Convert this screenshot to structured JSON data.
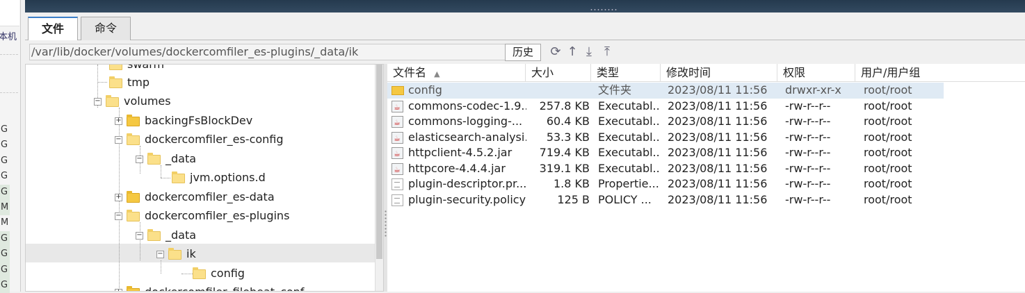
{
  "left_strip": {
    "host_label": "本机",
    "units": [
      "G",
      "G",
      "G",
      "G",
      "G",
      "M",
      "M",
      "G",
      "G",
      "G",
      "G"
    ]
  },
  "tabs": [
    {
      "label": "文件"
    },
    {
      "label": "命令"
    }
  ],
  "path_bar": {
    "path": "/var/lib/docker/volumes/dockercomfiler_es-plugins/_data/ik",
    "history_button": "历史",
    "icons": [
      "refresh-icon",
      "up-icon",
      "download-icon",
      "upload-icon"
    ]
  },
  "tree": {
    "nodes": [
      {
        "label": "swarm"
      },
      {
        "label": "tmp"
      },
      {
        "label": "volumes"
      },
      {
        "label": "backingFsBlockDev"
      },
      {
        "label": "dockercomfiler_es-config"
      },
      {
        "label": "_data"
      },
      {
        "label": "jvm.options.d"
      },
      {
        "label": "dockercomfiler_es-data"
      },
      {
        "label": "dockercomfiler_es-plugins"
      },
      {
        "label": "_data"
      },
      {
        "label": "ik"
      },
      {
        "label": "config"
      },
      {
        "label": "dockercomfiler_filebeat_conf"
      }
    ]
  },
  "file_list": {
    "columns": [
      "文件名",
      "大小",
      "类型",
      "修改时间",
      "权限",
      "用户/用户组"
    ],
    "sort_indicator": "▲",
    "rows": [
      {
        "icon": "folder-icon",
        "name": "config",
        "size": "",
        "type": "文件夹",
        "modified": "2023/08/11 11:56",
        "perm": "drwxr-xr-x",
        "owner": "root/root"
      },
      {
        "icon": "jar-icon",
        "name": "commons-codec-1.9....",
        "size": "257.8 KB",
        "type": "Executabl...",
        "modified": "2023/08/11 11:56",
        "perm": "-rw-r--r--",
        "owner": "root/root"
      },
      {
        "icon": "jar-icon",
        "name": "commons-logging-...",
        "size": "60.4 KB",
        "type": "Executabl...",
        "modified": "2023/08/11 11:56",
        "perm": "-rw-r--r--",
        "owner": "root/root"
      },
      {
        "icon": "jar-icon",
        "name": "elasticsearch-analysi...",
        "size": "53.3 KB",
        "type": "Executabl...",
        "modified": "2023/08/11 11:56",
        "perm": "-rw-r--r--",
        "owner": "root/root"
      },
      {
        "icon": "jar-icon",
        "name": "httpclient-4.5.2.jar",
        "size": "719.4 KB",
        "type": "Executabl...",
        "modified": "2023/08/11 11:56",
        "perm": "-rw-r--r--",
        "owner": "root/root"
      },
      {
        "icon": "jar-icon",
        "name": "httpcore-4.4.4.jar",
        "size": "319.1 KB",
        "type": "Executabl...",
        "modified": "2023/08/11 11:56",
        "perm": "-rw-r--r--",
        "owner": "root/root"
      },
      {
        "icon": "text-file-icon",
        "name": "plugin-descriptor.pr...",
        "size": "1.8 KB",
        "type": "Propertie...",
        "modified": "2023/08/11 11:56",
        "perm": "-rw-r--r--",
        "owner": "root/root"
      },
      {
        "icon": "file-icon",
        "name": "plugin-security.policy",
        "size": "125 B",
        "type": "POLICY ...",
        "modified": "2023/08/11 11:56",
        "perm": "-rw-r--r--",
        "owner": "root/root"
      }
    ]
  }
}
